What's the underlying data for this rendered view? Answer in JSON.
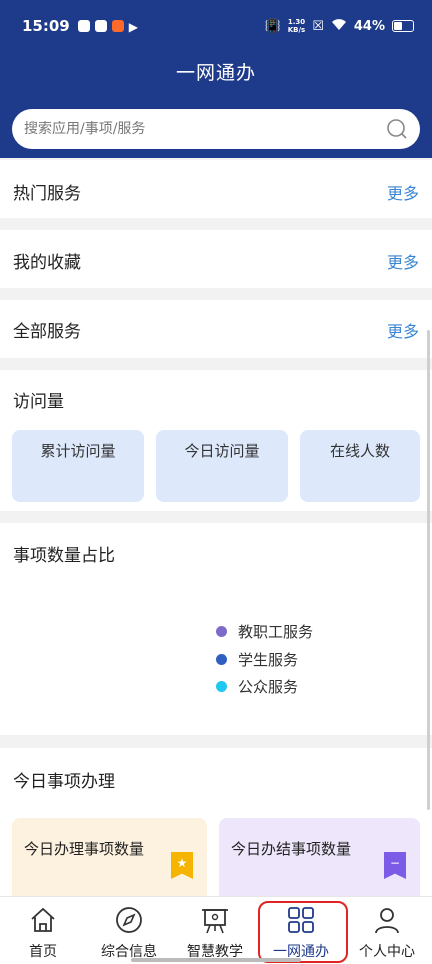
{
  "status": {
    "time": "15:09",
    "netspeed_value": "1.30",
    "netspeed_unit": "KB/s",
    "battery": "44%",
    "battery_level": 0.44
  },
  "header": {
    "title": "一网通办"
  },
  "search": {
    "placeholder": "搜索应用/事项/服务"
  },
  "sections": {
    "hot": {
      "title": "热门服务",
      "more": "更多"
    },
    "favorites": {
      "title": "我的收藏",
      "more": "更多"
    },
    "all": {
      "title": "全部服务",
      "more": "更多"
    }
  },
  "visits": {
    "title": "访问量",
    "items": [
      {
        "label": "累计访问量"
      },
      {
        "label": "今日访问量"
      },
      {
        "label": "在线人数"
      }
    ]
  },
  "ratio": {
    "title": "事项数量占比",
    "legend": [
      {
        "label": "教职工服务",
        "color": "#7e6bc9"
      },
      {
        "label": "学生服务",
        "color": "#2f5fbf"
      },
      {
        "label": "公众服务",
        "color": "#1ec8f0"
      }
    ]
  },
  "today": {
    "title": "今日事项办理",
    "items": [
      {
        "label": "今日办理事项数量",
        "bg": "#fdf2df",
        "badge_color": "#f5b400"
      },
      {
        "label": "今日办结事项数量",
        "bg": "#eee6fb",
        "badge_color": "#7c5ce6"
      }
    ]
  },
  "tabs": [
    {
      "label": "首页",
      "icon": "home-icon"
    },
    {
      "label": "综合信息",
      "icon": "compass-icon"
    },
    {
      "label": "智慧教学",
      "icon": "teaching-board-icon"
    },
    {
      "label": "一网通办",
      "icon": "grid-icon",
      "active": true
    },
    {
      "label": "个人中心",
      "icon": "person-icon"
    }
  ]
}
